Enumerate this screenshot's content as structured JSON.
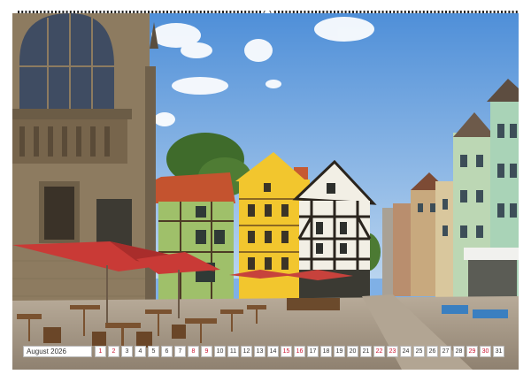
{
  "calendar": {
    "month_label": "August 2026",
    "days": [
      {
        "n": "1",
        "we": true
      },
      {
        "n": "2",
        "we": true
      },
      {
        "n": "3",
        "we": false
      },
      {
        "n": "4",
        "we": false
      },
      {
        "n": "5",
        "we": false
      },
      {
        "n": "6",
        "we": false
      },
      {
        "n": "7",
        "we": false
      },
      {
        "n": "8",
        "we": true
      },
      {
        "n": "9",
        "we": true
      },
      {
        "n": "10",
        "we": false
      },
      {
        "n": "11",
        "we": false
      },
      {
        "n": "12",
        "we": false
      },
      {
        "n": "13",
        "we": false
      },
      {
        "n": "14",
        "we": false
      },
      {
        "n": "15",
        "we": true
      },
      {
        "n": "16",
        "we": true
      },
      {
        "n": "17",
        "we": false
      },
      {
        "n": "18",
        "we": false
      },
      {
        "n": "19",
        "we": false
      },
      {
        "n": "20",
        "we": false
      },
      {
        "n": "21",
        "we": false
      },
      {
        "n": "22",
        "we": true
      },
      {
        "n": "23",
        "we": true
      },
      {
        "n": "24",
        "we": false
      },
      {
        "n": "25",
        "we": false
      },
      {
        "n": "26",
        "we": false
      },
      {
        "n": "27",
        "we": false
      },
      {
        "n": "28",
        "we": false
      },
      {
        "n": "29",
        "we": true
      },
      {
        "n": "30",
        "we": true
      },
      {
        "n": "31",
        "we": false
      }
    ],
    "weekend_color": "#c8142f"
  },
  "photo": {
    "subject": "half-timbered-old-town-square-with-red-umbrellas",
    "colors": {
      "sky": "#5f9ee0",
      "yellow_house": "#f2c62e",
      "green_house": "#9fc06a",
      "umbrella": "#c93a36",
      "cobblestone": "#a79a8a",
      "stone_church": "#8d7b60"
    }
  }
}
